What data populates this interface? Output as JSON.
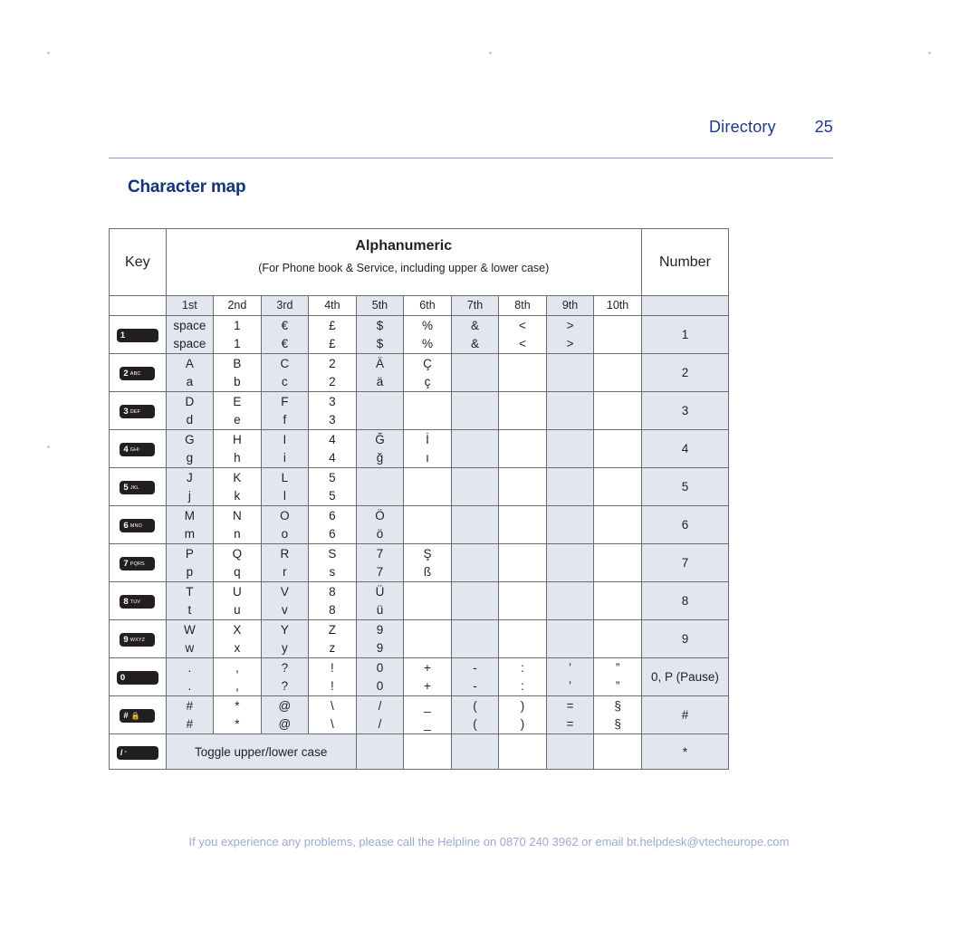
{
  "page": {
    "running_head_label": "Directory",
    "page_number": "25",
    "section_title": "Character map",
    "footer": "If you experience any problems, please call the Helpline on 0870 240 3962 or email bt.helpdesk@vtecheurope.com"
  },
  "colors": {
    "heading_blue": "#16327d",
    "runhead_blue": "#1b3a8c",
    "rule_blue": "#8e9dcf",
    "shade": "#e2e6ef",
    "footer_blue": "#9aa9d8",
    "key_black": "#231f20"
  },
  "table": {
    "header": {
      "key": "Key",
      "alphanumeric": "Alphanumeric",
      "alphanumeric_note": "(For Phone book & Service, including upper & lower case)",
      "number": "Number"
    },
    "ordinals": [
      "1st",
      "2nd",
      "3rd",
      "4th",
      "5th",
      "6th",
      "7th",
      "8th",
      "9th",
      "10th"
    ],
    "shaded_ordinal_indexes": [
      0,
      2,
      4,
      6,
      8
    ],
    "rows": [
      {
        "key_icon": "key-1",
        "key_num": "1",
        "key_sub": "",
        "upper": [
          "space",
          "1",
          "€",
          "£",
          "$",
          "%",
          "&",
          "<",
          ">",
          ""
        ],
        "lower": [
          "space",
          "1",
          "€",
          "£",
          "$",
          "%",
          "&",
          "<",
          ">",
          ""
        ],
        "number": "1"
      },
      {
        "key_icon": "key-2",
        "key_num": "2",
        "key_sub": "ABC",
        "upper": [
          "A",
          "B",
          "C",
          "2",
          "Ä",
          "Ç",
          "",
          "",
          "",
          ""
        ],
        "lower": [
          "a",
          "b",
          "c",
          "2",
          "ä",
          "ç",
          "",
          "",
          "",
          ""
        ],
        "number": "2"
      },
      {
        "key_icon": "key-3",
        "key_num": "3",
        "key_sub": "DEF",
        "upper": [
          "D",
          "E",
          "F",
          "3",
          "",
          "",
          "",
          "",
          "",
          ""
        ],
        "lower": [
          "d",
          "e",
          "f",
          "3",
          "",
          "",
          "",
          "",
          "",
          ""
        ],
        "number": "3"
      },
      {
        "key_icon": "key-4",
        "key_num": "4",
        "key_sub": "GHI",
        "upper": [
          "G",
          "H",
          "I",
          "4",
          "Ğ",
          "İ",
          "",
          "",
          "",
          ""
        ],
        "lower": [
          "g",
          "h",
          "i",
          "4",
          "ğ",
          "ı",
          "",
          "",
          "",
          ""
        ],
        "number": "4"
      },
      {
        "key_icon": "key-5",
        "key_num": "5",
        "key_sub": "JKL",
        "upper": [
          "J",
          "K",
          "L",
          "5",
          "",
          "",
          "",
          "",
          "",
          ""
        ],
        "lower": [
          "j",
          "k",
          "l",
          "5",
          "",
          "",
          "",
          "",
          "",
          ""
        ],
        "number": "5"
      },
      {
        "key_icon": "key-6",
        "key_num": "6",
        "key_sub": "MNO",
        "upper": [
          "M",
          "N",
          "O",
          "6",
          "Ö",
          "",
          "",
          "",
          "",
          ""
        ],
        "lower": [
          "m",
          "n",
          "o",
          "6",
          "ö",
          "",
          "",
          "",
          "",
          ""
        ],
        "number": "6"
      },
      {
        "key_icon": "key-7",
        "key_num": "7",
        "key_sub": "PQRS",
        "upper": [
          "P",
          "Q",
          "R",
          "S",
          "7",
          "Ş",
          "",
          "",
          "",
          ""
        ],
        "lower": [
          "p",
          "q",
          "r",
          "s",
          "7",
          "ß",
          "",
          "",
          "",
          ""
        ],
        "number": "7"
      },
      {
        "key_icon": "key-8",
        "key_num": "8",
        "key_sub": "TUV",
        "upper": [
          "T",
          "U",
          "V",
          "8",
          "Ü",
          "",
          "",
          "",
          "",
          ""
        ],
        "lower": [
          "t",
          "u",
          "v",
          "8",
          "ü",
          "",
          "",
          "",
          "",
          ""
        ],
        "number": "8"
      },
      {
        "key_icon": "key-9",
        "key_num": "9",
        "key_sub": "WXYZ",
        "upper": [
          "W",
          "X",
          "Y",
          "Z",
          "9",
          "",
          "",
          "",
          "",
          ""
        ],
        "lower": [
          "w",
          "x",
          "y",
          "z",
          "9",
          "",
          "",
          "",
          "",
          ""
        ],
        "number": "9"
      },
      {
        "key_icon": "key-0",
        "key_num": "0",
        "key_sub": "",
        "upper": [
          ".",
          ",",
          "?",
          "!",
          "0",
          "+",
          "-",
          ":",
          "’",
          "”"
        ],
        "lower": [
          ".",
          ",",
          "?",
          "!",
          "0",
          "+",
          "-",
          ":",
          "’",
          "”"
        ],
        "number": "0, P (Pause)"
      },
      {
        "key_icon": "key-hash",
        "key_num": "#",
        "key_sub": "lock-icon",
        "upper": [
          "#",
          "*",
          "@",
          "\\",
          "/",
          "_",
          "(",
          ")",
          "=",
          "§"
        ],
        "lower": [
          "#",
          "*",
          "@",
          "\\",
          "/",
          "_",
          "(",
          ")",
          "=",
          "§"
        ],
        "number": "#"
      }
    ],
    "toggle_row": {
      "key_icon": "key-star",
      "key_num": "/",
      "key_sub": "*",
      "label": "Toggle upper/lower case",
      "number": "*"
    }
  }
}
